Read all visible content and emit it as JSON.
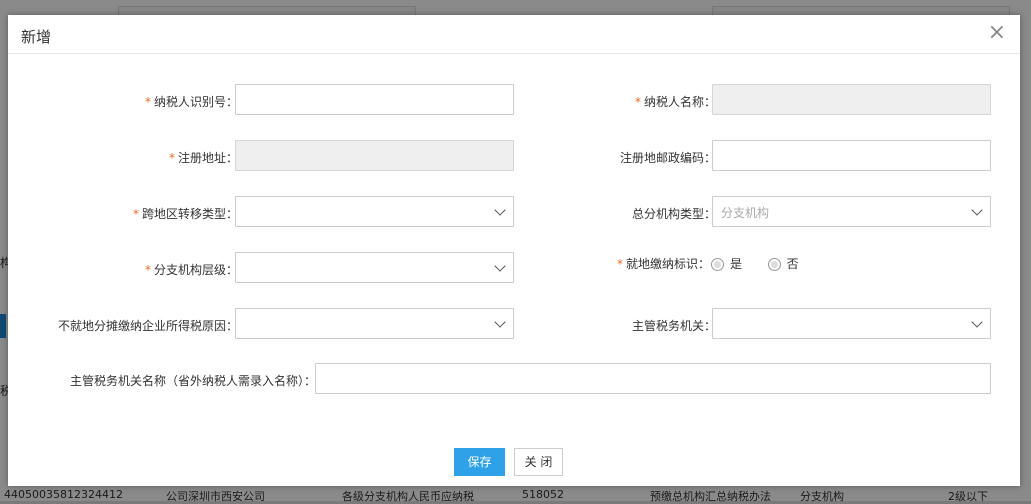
{
  "background": {
    "rows_text": {
      "frag_a": "构",
      "frag_b": "税"
    },
    "bottom_row": [
      "44050035812324412",
      "公司深圳市西安公司",
      "各级分支机构人民币应纳税",
      "518052",
      "预缴总机构汇总纳税办法",
      "分支机构",
      "2级以下"
    ]
  },
  "dialog": {
    "title": "新增",
    "close_icon": "close-icon",
    "fields": {
      "taxpayer_id": {
        "label": "纳税人识别号：",
        "required": true,
        "value": ""
      },
      "taxpayer_name": {
        "label": "纳税人名称：",
        "required": true,
        "value": ""
      },
      "reg_address": {
        "label": "注册地址：",
        "required": true,
        "value": ""
      },
      "reg_postcode": {
        "label": "注册地邮政编码：",
        "required": false,
        "value": ""
      },
      "cross_region_type": {
        "label": "跨地区转移类型：",
        "required": true,
        "value": ""
      },
      "org_type": {
        "label": "总分机构类型：",
        "required": false,
        "value": "分支机构"
      },
      "branch_level": {
        "label": "分支机构层级：",
        "required": true,
        "value": ""
      },
      "local_payment_flag": {
        "label": "就地缴纳标识：",
        "required": true,
        "options": [
          "是",
          "否"
        ]
      },
      "not_local_reason": {
        "label": "不就地分摊缴纳企业所得税原因：",
        "required": false,
        "value": ""
      },
      "tax_authority": {
        "label": "主管税务机关：",
        "required": false,
        "value": ""
      },
      "tax_authority_name": {
        "label": "主管税务机关名称（省外纳税人需录入名称）：",
        "required": false,
        "value": ""
      }
    },
    "buttons": {
      "save": "保存",
      "close": "关 闭"
    },
    "required_mark": "*"
  },
  "colors": {
    "required": "#e86d22",
    "primary": "#2ea1e8"
  }
}
